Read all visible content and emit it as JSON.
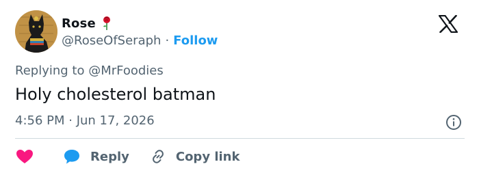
{
  "author": {
    "display_name": "Rose",
    "handle": "@RoseOfSeraph",
    "separator": "·",
    "follow_label": "Follow",
    "avatar_icon": "bastet-cat-avatar",
    "emoji_icon": "rose-icon"
  },
  "reply": {
    "prefix": "Replying to ",
    "mention": "@MrFoodies"
  },
  "tweet": {
    "text": "Holy cholesterol batman",
    "timestamp": "4:56 PM · Jun 17, 2026"
  },
  "actions": {
    "like_icon": "heart-icon",
    "reply_label": "Reply",
    "copy_label": "Copy link"
  },
  "colors": {
    "accent": "#1d9bf0",
    "like": "#f91880",
    "text_primary": "#0f1419",
    "text_secondary": "#536471",
    "divider": "#cfd9de"
  }
}
